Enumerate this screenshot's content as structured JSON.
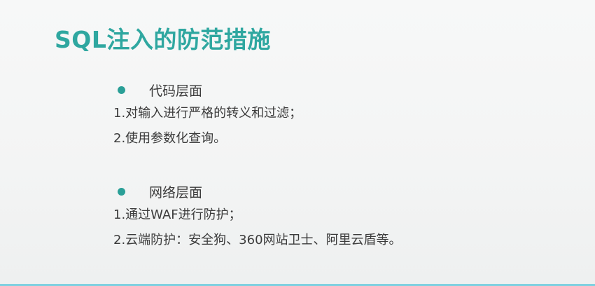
{
  "title": "SQL注入的防范措施",
  "sections": [
    {
      "heading": "代码层面",
      "lines": [
        "1.对输入进行严格的转义和过滤；",
        "2.使用参数化查询。"
      ]
    },
    {
      "heading": "网络层面",
      "lines": [
        "1.通过WAF进行防护；",
        "2.云端防护：安全狗、360网站卫士、阿里云盾等。"
      ]
    }
  ],
  "colors": {
    "title": "#2fa7a0",
    "bullet": "#2a9f97",
    "text": "#3c3c3c",
    "background": "#f4f5f5",
    "bottom_line": "#7fd0e0"
  }
}
